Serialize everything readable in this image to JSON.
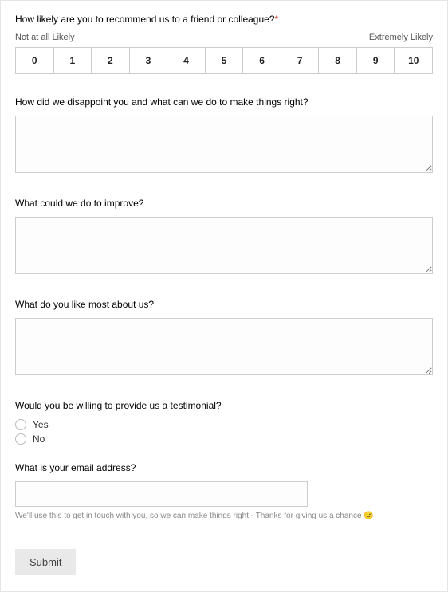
{
  "q_recommend": {
    "label": "How likely are you to recommend us to a friend or colleague?",
    "required_star": "*",
    "left_label": "Not at all Likely",
    "right_label": "Extremely Likely",
    "options": [
      "0",
      "1",
      "2",
      "3",
      "4",
      "5",
      "6",
      "7",
      "8",
      "9",
      "10"
    ]
  },
  "q_disappoint": {
    "label": "How did we disappoint you and what can we do to make things right?"
  },
  "q_improve": {
    "label": "What could we do to improve?"
  },
  "q_like_most": {
    "label": "What do you like most about us?"
  },
  "q_testimonial": {
    "label": "Would you be willing to provide us a testimonial?",
    "options": {
      "yes": "Yes",
      "no": "No"
    }
  },
  "q_email": {
    "label": "What is your email address?",
    "helper": "We'll use this to get in touch with you, so we can make things right - Thanks for giving us a chance ",
    "emoji": "🙂"
  },
  "submit_label": "Submit"
}
